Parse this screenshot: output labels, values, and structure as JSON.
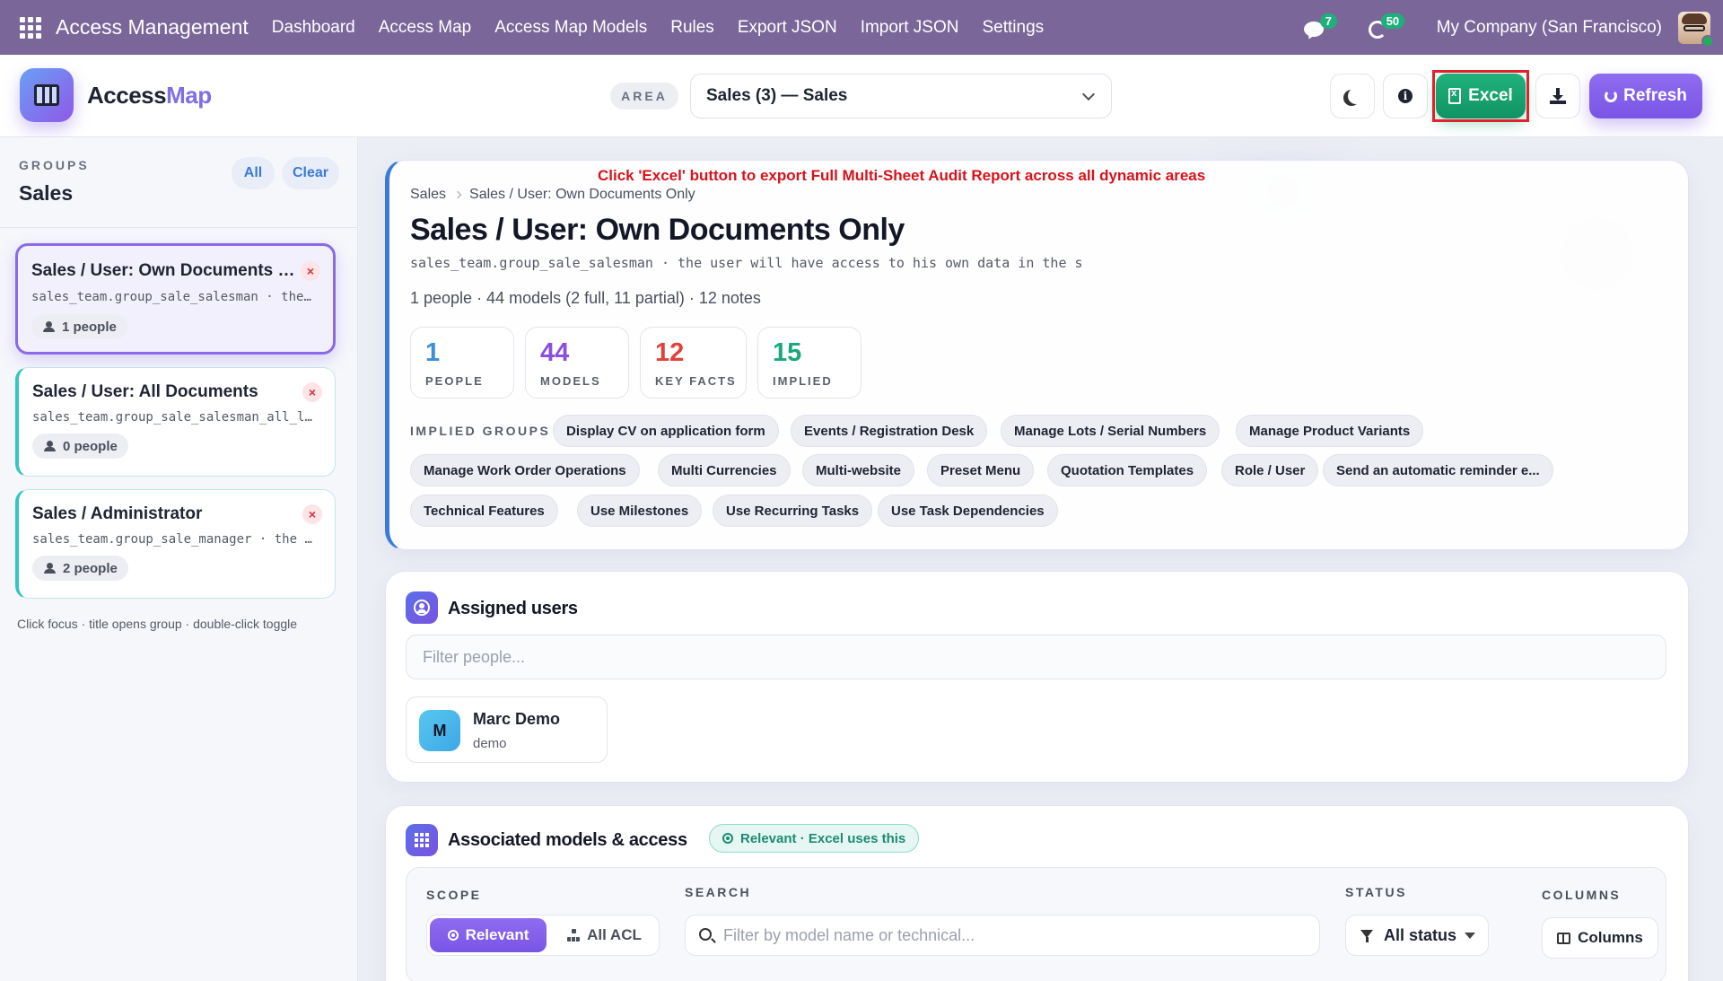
{
  "topbar": {
    "brand": "Access Management",
    "nav": [
      "Dashboard",
      "Access Map",
      "Access Map Models",
      "Rules",
      "Export JSON",
      "Import JSON",
      "Settings"
    ],
    "chat_count": "7",
    "activity_count": "50",
    "company": "My Company (San Francisco)"
  },
  "header": {
    "app_title_a": "Access",
    "app_title_b": "Map",
    "area_label": "AREA",
    "area_value": "Sales (3) — Sales",
    "excel_label": "Excel",
    "refresh_label": "Refresh"
  },
  "sidebar": {
    "groups_label": "GROUPS",
    "title": "Sales",
    "all_label": "All",
    "clear_label": "Clear",
    "groups": [
      {
        "title": "Sales / User: Own Documents Only",
        "tech": "sales_team.group_sale_salesman · the user will have access to his own data",
        "people": "1 people"
      },
      {
        "title": "Sales / User: All Documents",
        "tech": "sales_team.group_sale_salesman_all_leads",
        "people": "0 people"
      },
      {
        "title": "Sales / Administrator",
        "tech": "sales_team.group_sale_manager · the user will have access",
        "people": "2 people"
      }
    ],
    "hint": "Click focus · title opens group · double-click toggle"
  },
  "hint_red": "Click 'Excel' button to export Full Multi-Sheet Audit Report across all dynamic areas",
  "detail": {
    "crumb_1": "Sales",
    "crumb_2": "Sales / User: Own Documents Only",
    "title": "Sales / User: Own Documents Only",
    "tech": "sales_team.group_sale_salesman · the user will have access to his own data in the s",
    "summary": "1 people · 44 models (2 full, 11 partial) · 12 notes",
    "stats": [
      {
        "num": "1",
        "label": "PEOPLE",
        "color": "#3a8fd5"
      },
      {
        "num": "44",
        "label": "MODELS",
        "color": "#8a4fe0"
      },
      {
        "num": "12",
        "label": "KEY FACTS",
        "color": "#e0413c"
      },
      {
        "num": "15",
        "label": "IMPLIED",
        "color": "#1aa878"
      }
    ],
    "implied_label": "IMPLIED GROUPS",
    "implied": [
      "Display CV on application form",
      "Events / Registration Desk",
      "Manage Lots / Serial Numbers",
      "Manage Product Variants",
      "Manage Work Order Operations",
      "Multi Currencies",
      "Multi-website",
      "Preset Menu",
      "Quotation Templates",
      "Role / User",
      "Send an automatic reminder e...",
      "Technical Features",
      "Use Milestones",
      "Use Recurring Tasks",
      "Use Task Dependencies"
    ]
  },
  "users_panel": {
    "title": "Assigned users",
    "filter_placeholder": "Filter people...",
    "users": [
      {
        "initial": "M",
        "name": "Marc Demo",
        "login": "demo"
      }
    ]
  },
  "models_panel": {
    "title": "Associated models & access",
    "tag": "Relevant · Excel uses this",
    "scope_label": "SCOPE",
    "search_label": "SEARCH",
    "status_label": "STATUS",
    "columns_label": "COLUMNS",
    "scope_on": "Relevant",
    "scope_off": "All ACL",
    "search_placeholder": "Filter by model name or technical...",
    "status_value": "All status",
    "columns_btn": "Columns"
  }
}
